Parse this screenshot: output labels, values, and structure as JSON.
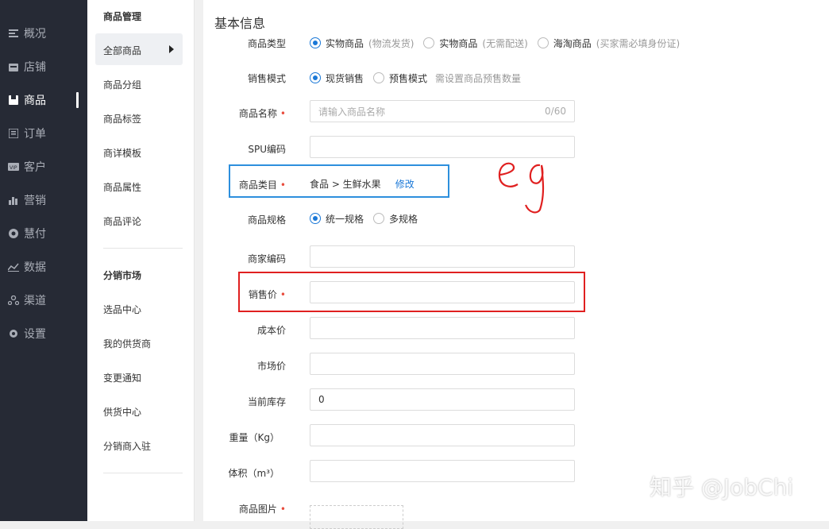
{
  "sidebar": {
    "items": [
      {
        "icon": "overview-icon",
        "label": "概况"
      },
      {
        "icon": "store-icon",
        "label": "店铺"
      },
      {
        "icon": "product-icon",
        "label": "商品"
      },
      {
        "icon": "order-icon",
        "label": "订单"
      },
      {
        "icon": "customer-icon",
        "label": "客户"
      },
      {
        "icon": "marketing-icon",
        "label": "营销"
      },
      {
        "icon": "payment-icon",
        "label": "慧付"
      },
      {
        "icon": "data-icon",
        "label": "数据"
      },
      {
        "icon": "channel-icon",
        "label": "渠道"
      },
      {
        "icon": "settings-icon",
        "label": "设置"
      }
    ],
    "active_index": 2
  },
  "subnav": {
    "title1": "商品管理",
    "items1": [
      "全部商品",
      "商品分组",
      "商品标签",
      "商详模板",
      "商品属性",
      "商品评论"
    ],
    "title2": "分销市场",
    "items2": [
      "选品中心",
      "我的供货商",
      "变更通知",
      "供货中心",
      "分销商入驻"
    ]
  },
  "form": {
    "section_title": "基本信息",
    "product_type": {
      "label": "商品类型",
      "options": [
        {
          "name": "实物商品",
          "hint": "(物流发货)",
          "selected": true
        },
        {
          "name": "实物商品",
          "hint": "(无需配送)",
          "selected": false
        },
        {
          "name": "海淘商品",
          "hint": "(买家需必填身份证)",
          "selected": false
        }
      ]
    },
    "sale_mode": {
      "label": "销售模式",
      "options": [
        {
          "name": "现货销售",
          "selected": true
        },
        {
          "name": "预售模式",
          "selected": false
        }
      ],
      "hint": "需设置商品预售数量"
    },
    "product_name": {
      "label": "商品名称",
      "required": true,
      "placeholder": "请输入商品名称",
      "counter": "0/60"
    },
    "spu_code": {
      "label": "SPU编码"
    },
    "category": {
      "label": "商品类目",
      "required": true,
      "value": "食品 > 生鲜水果",
      "action": "修改"
    },
    "spec": {
      "label": "商品规格",
      "options": [
        {
          "name": "统一规格",
          "selected": true
        },
        {
          "name": "多规格",
          "selected": false
        }
      ]
    },
    "merchant_code": {
      "label": "商家编码"
    },
    "sale_price": {
      "label": "销售价",
      "required": true
    },
    "cost_price": {
      "label": "成本价"
    },
    "market_price": {
      "label": "市场价"
    },
    "stock": {
      "label": "当前库存",
      "value": "0"
    },
    "weight": {
      "label": "重量（Kg）"
    },
    "volume": {
      "label": "体积（m³）"
    },
    "images": {
      "label": "商品图片",
      "required": true
    }
  },
  "annotation": {
    "text": "eg",
    "blue_box_color": "#2d8fdd",
    "red_box_color": "#e02020"
  },
  "watermark": "知乎 @JobChi"
}
